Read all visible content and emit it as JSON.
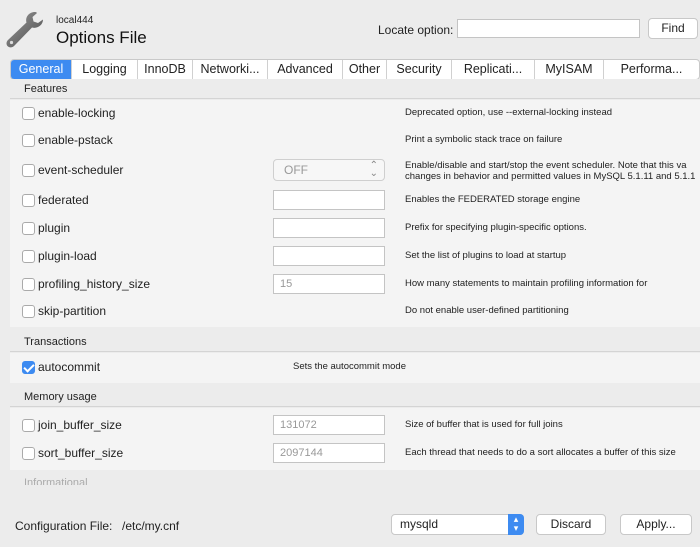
{
  "header": {
    "subtitle": "local444",
    "title": "Options File",
    "locate_label": "Locate option:",
    "locate_value": "",
    "find_label": "Find"
  },
  "tabs": [
    {
      "label": "General",
      "active": true
    },
    {
      "label": "Logging"
    },
    {
      "label": "InnoDB"
    },
    {
      "label": "Networki..."
    },
    {
      "label": "Advanced"
    },
    {
      "label": "Other"
    },
    {
      "label": "Security"
    },
    {
      "label": "Replicati..."
    },
    {
      "label": "MyISAM"
    },
    {
      "label": "Performa..."
    }
  ],
  "sections": {
    "features": "Features",
    "transactions": "Transactions",
    "memory": "Memory usage",
    "informational": "Informational"
  },
  "options": {
    "enable_locking": {
      "name": "enable-locking",
      "desc": "Deprecated option, use --external-locking instead",
      "checked": false
    },
    "enable_pstack": {
      "name": "enable-pstack",
      "desc": "Print a symbolic stack trace on failure",
      "checked": false
    },
    "event_scheduler": {
      "name": "event-scheduler",
      "value": "OFF",
      "desc_1": "Enable/disable and start/stop the event scheduler. Note that this va",
      "desc_2": "changes in behavior and permitted values in MySQL 5.1.11 and 5.1.1",
      "checked": false
    },
    "federated": {
      "name": "federated",
      "value": "",
      "desc": "Enables the FEDERATED storage engine",
      "checked": false
    },
    "plugin": {
      "name": "plugin",
      "value": "",
      "desc": "Prefix for specifying plugin-specific options.",
      "checked": false
    },
    "plugin_load": {
      "name": "plugin-load",
      "value": "",
      "desc": "Set the list of plugins to load at startup",
      "checked": false
    },
    "profiling_history_size": {
      "name": "profiling_history_size",
      "value": "15",
      "desc": "How many statements to maintain profiling information for",
      "checked": false
    },
    "skip_partition": {
      "name": "skip-partition",
      "desc": "Do not enable user-defined partitioning",
      "checked": false
    },
    "autocommit": {
      "name": "autocommit",
      "desc": "Sets the autocommit mode",
      "checked": true
    },
    "join_buffer_size": {
      "name": "join_buffer_size",
      "value": "131072",
      "desc": "Size of buffer that is used for full joins",
      "checked": false
    },
    "sort_buffer_size": {
      "name": "sort_buffer_size",
      "value": "2097144",
      "desc": "Each thread that needs to do a sort allocates a buffer of this size",
      "checked": false
    }
  },
  "footer": {
    "config_label": "Configuration File:",
    "config_path": "/etc/my.cnf",
    "section_select": "mysqld",
    "discard_label": "Discard",
    "apply_label": "Apply..."
  },
  "colors": {
    "accent": "#3d8bf1"
  },
  "icons": {
    "app": "wrench-icon",
    "checkbox_checked": "checkmark-icon",
    "select": "chevron-up-down-icon"
  }
}
